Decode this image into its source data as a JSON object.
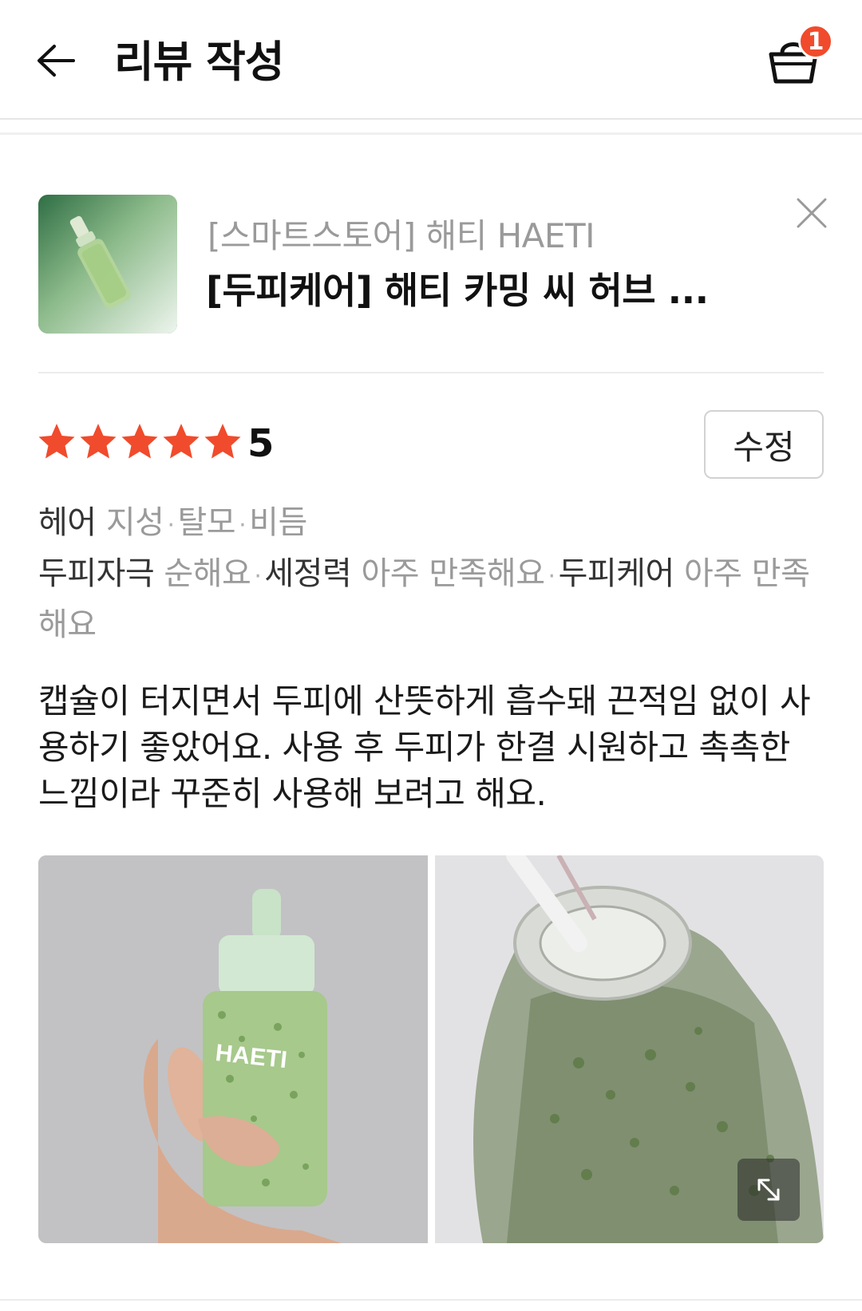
{
  "header": {
    "title": "리뷰 작성",
    "cart_count": "1",
    "back_icon": "arrow-left-icon",
    "cart_icon": "basket-icon"
  },
  "product": {
    "store": "[스마트스토어] 해티 HAETI",
    "name": "[두피케어] 해티 카밍 씨 허브 ..."
  },
  "rating": {
    "stars": 5,
    "value": "5",
    "star_color": "#f04b2c"
  },
  "edit_button": "수정",
  "attributes": {
    "line1": [
      {
        "key": "헤어",
        "value": "지성"
      },
      {
        "value": "탈모"
      },
      {
        "value": "비듬"
      }
    ],
    "line2": [
      {
        "key": "두피자극",
        "value": "순해요"
      },
      {
        "key": "세정력",
        "value": "아주 만족해요"
      },
      {
        "key": "두피케어",
        "value": "아주 만족해요"
      }
    ]
  },
  "review": {
    "text": "캡슐이 터지면서 두피에 산뜻하게 흡수돼 끈적임 없이 사용하기 좋았어요. 사용 후 두피가 한결 시원하고 촉촉한 느낌이라 꾸준히 사용해 보려고 해요."
  },
  "photos": [
    {
      "name": "photo-hand-holding-bottle",
      "label": "HAETI"
    },
    {
      "name": "photo-bottle-closeup"
    }
  ],
  "colors": {
    "accent": "#f04b2c",
    "muted": "#9a9a9a"
  }
}
